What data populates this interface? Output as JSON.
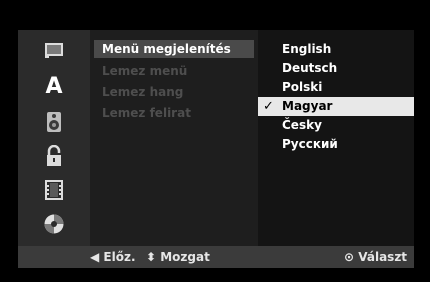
{
  "sidebar": {
    "items": [
      {
        "icon": "disc-menu-icon"
      },
      {
        "icon": "language-icon",
        "glyph": "A"
      },
      {
        "icon": "speaker-icon"
      },
      {
        "icon": "lock-icon"
      },
      {
        "icon": "film-icon"
      },
      {
        "icon": "disc-icon"
      }
    ]
  },
  "menu": {
    "items": [
      {
        "label": "Menü megjelenítés"
      },
      {
        "label": "Lemez menü"
      },
      {
        "label": "Lemez hang"
      },
      {
        "label": "Lemez felirat"
      }
    ]
  },
  "languages": {
    "items": [
      {
        "label": "English"
      },
      {
        "label": "Deutsch"
      },
      {
        "label": "Polski"
      },
      {
        "label": "Magyar"
      },
      {
        "label": "Česky"
      },
      {
        "label": "Русский"
      }
    ],
    "selected": "Magyar",
    "check_glyph": "✓"
  },
  "footer": {
    "prev_label": "◀ Előz.",
    "move_label": "⬍ Mozgat",
    "select_label": "⊙ Választ"
  }
}
